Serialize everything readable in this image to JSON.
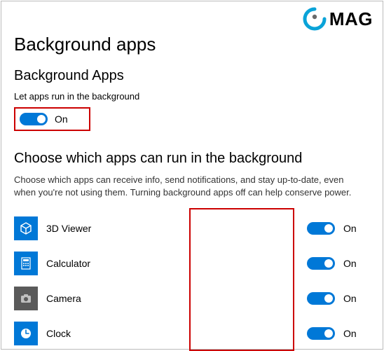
{
  "logo": {
    "text": "MAG"
  },
  "page": {
    "title": "Background apps"
  },
  "section1": {
    "title": "Background Apps",
    "desc": "Let apps run in the background",
    "toggle_label": "On"
  },
  "section2": {
    "title": "Choose which apps can run in the background",
    "desc": "Choose which apps can receive info, send notifications, and stay up-to-date, even when you're not using them. Turning background apps off can help conserve power."
  },
  "apps": [
    {
      "name": "3D Viewer",
      "state": "On",
      "icon": "cube-icon"
    },
    {
      "name": "Calculator",
      "state": "On",
      "icon": "calculator-icon"
    },
    {
      "name": "Camera",
      "state": "On",
      "icon": "camera-icon"
    },
    {
      "name": "Clock",
      "state": "On",
      "icon": "clock-icon"
    }
  ]
}
